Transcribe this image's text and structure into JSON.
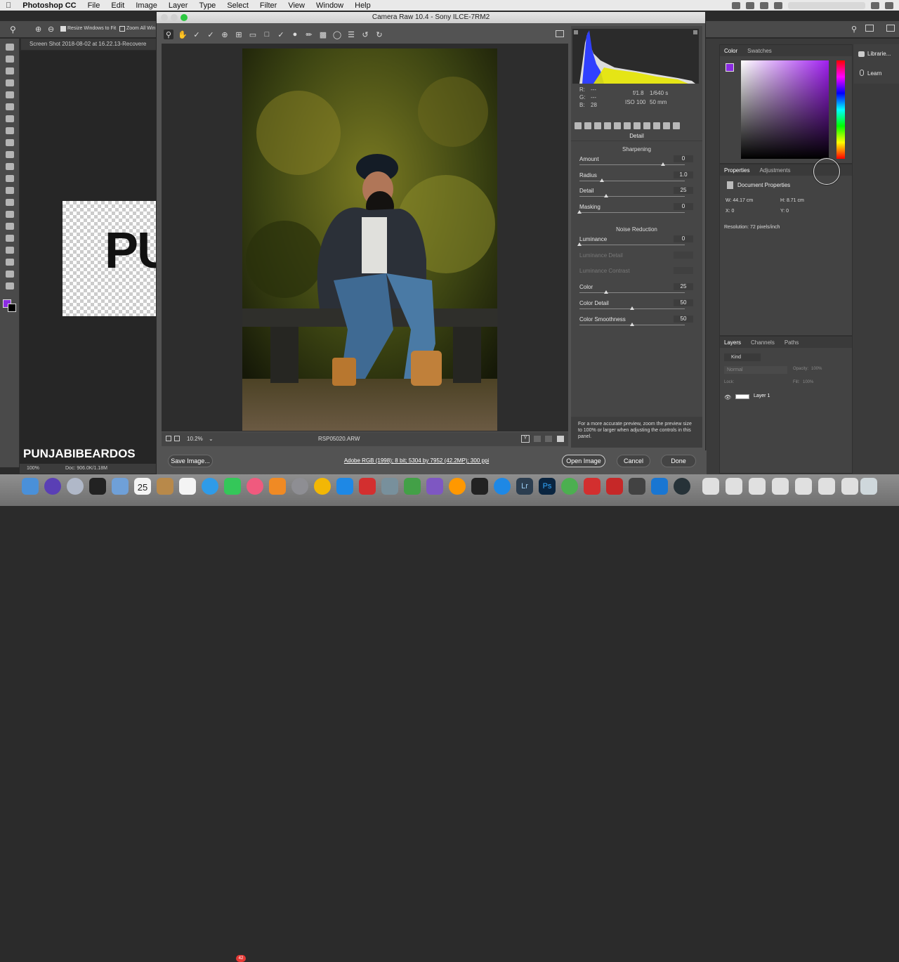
{
  "menubar": {
    "app": "Photoshop CC",
    "items": [
      "File",
      "Edit",
      "Image",
      "Layer",
      "Type",
      "Select",
      "Filter",
      "View",
      "Window",
      "Help"
    ]
  },
  "options_bar": {
    "resize_label": "Resize Windows to Fit",
    "zoom_all_label": "Zoom All Win"
  },
  "ps_doc_tab": "Screen Shot 2018-08-02 at 16.22.13-Recovere",
  "canvas_text": "PU",
  "watermark": "PUNJABIBEARDOS",
  "ps_status": {
    "zoom": "100%",
    "doc": "Doc: 906.0K/1.18M"
  },
  "camera_raw": {
    "title": "Camera Raw 10.4  -  Sony ILCE-7RM2",
    "info": {
      "r_label": "R:",
      "r_val": "---",
      "g_label": "G:",
      "g_val": "---",
      "b_label": "B:",
      "b_val": "28",
      "aperture": "f/1.8",
      "shutter": "1/640 s",
      "iso": "ISO 100",
      "focal": "50 mm"
    },
    "panel_title": "Detail",
    "sharpening_title": "Sharpening",
    "noise_title": "Noise Reduction",
    "sharpening": [
      {
        "label": "Amount",
        "value": "0",
        "pos": 0.79
      },
      {
        "label": "Radius",
        "value": "1.0",
        "pos": 0.21
      },
      {
        "label": "Detail",
        "value": "25",
        "pos": 0.25
      },
      {
        "label": "Masking",
        "value": "0",
        "pos": 0.0
      }
    ],
    "noise": [
      {
        "label": "Luminance",
        "value": "0",
        "pos": 0.0,
        "disabled": false
      },
      {
        "label": "Luminance Detail",
        "value": "",
        "pos": null,
        "disabled": true
      },
      {
        "label": "Luminance Contrast",
        "value": "",
        "pos": null,
        "disabled": true
      },
      {
        "label": "Color",
        "value": "25",
        "pos": 0.25,
        "disabled": false
      },
      {
        "label": "Color Detail",
        "value": "50",
        "pos": 0.5,
        "disabled": false
      },
      {
        "label": "Color Smoothness",
        "value": "50",
        "pos": 0.5,
        "disabled": false
      }
    ],
    "tip": "For a more accurate preview, zoom the preview size to 100% or larger when adjusting the controls in this panel.",
    "zoom": "10.2%",
    "filename": "RSP05020.ARW",
    "workflow": "Adobe RGB (1998); 8 bit; 5304 by 7952 (42.2MP); 300 ppi",
    "buttons": {
      "save": "Save Image...",
      "open": "Open Image",
      "cancel": "Cancel",
      "done": "Done"
    }
  },
  "color_panel": {
    "tabs": [
      "Color",
      "Swatches"
    ],
    "fg_color": "#8b2be2"
  },
  "side_panel": {
    "libraries": "Librarie...",
    "learn": "Learn"
  },
  "properties_panel": {
    "tabs": [
      "Properties",
      "Adjustments"
    ],
    "header": "Document Properties",
    "w": "W:  44.17 cm",
    "h": "H:  8.71 cm",
    "x": "X:  0",
    "y": "Y:  0",
    "resolution": "Resolution: 72 pixels/inch"
  },
  "layers_panel": {
    "tabs": [
      "Layers",
      "Channels",
      "Paths"
    ],
    "kind": "Kind",
    "blend": "Normal",
    "opacity_label": "Opacity:",
    "opacity": "100%",
    "lock_label": "Lock:",
    "fill_label": "Fill:",
    "fill": "100%",
    "layer_name": "Layer 1"
  },
  "dock": {
    "calendar_day": "25",
    "badge": "42"
  }
}
